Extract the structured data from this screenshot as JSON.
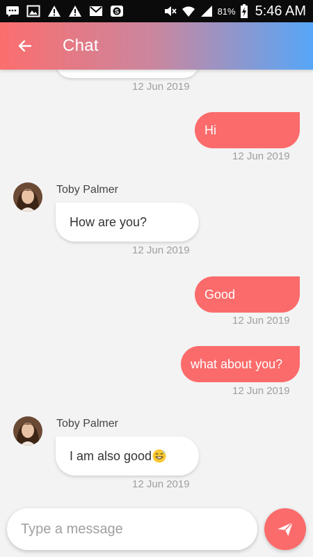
{
  "status_bar": {
    "battery_percent": "81%",
    "time": "5:46 AM",
    "left_icons": [
      "message-icon",
      "image-icon",
      "warning-icon",
      "warning-icon",
      "mail-icon",
      "skype-icon"
    ],
    "right_icons": [
      "mute-icon",
      "wifi-icon",
      "signal-icon",
      "battery-charging-icon"
    ]
  },
  "app_bar": {
    "title": "Chat",
    "back_icon": "arrow-left-icon",
    "gradient": [
      "#fb6e6e",
      "#56a6f8"
    ]
  },
  "messages": [
    {
      "direction": "incoming",
      "partial": true,
      "timestamp": "12 Jun 2019"
    },
    {
      "direction": "outgoing",
      "text": "Hi",
      "timestamp": "12 Jun 2019"
    },
    {
      "direction": "incoming",
      "sender": "Toby Palmer",
      "text": "How are you?",
      "timestamp": "12 Jun 2019"
    },
    {
      "direction": "outgoing",
      "text": "Good",
      "timestamp": "12 Jun 2019"
    },
    {
      "direction": "outgoing",
      "text": "what about you?",
      "timestamp": "12 Jun 2019"
    },
    {
      "direction": "incoming",
      "sender": "Toby Palmer",
      "text": "I am also good",
      "emoji": "grinning-sweat-emoji",
      "timestamp": "12 Jun 2019"
    }
  ],
  "composer": {
    "placeholder": "Type a message",
    "value": "",
    "send_icon": "send-icon"
  },
  "colors": {
    "accent": "#fb6b6b",
    "background": "#f3f3f3",
    "timestamp": "#9e9e9e"
  }
}
